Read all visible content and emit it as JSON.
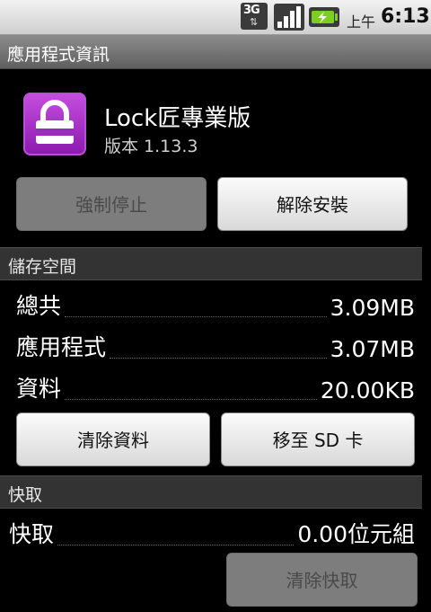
{
  "status_bar": {
    "network": "3G",
    "ampm": "上午",
    "time": "6:13",
    "icons": [
      "3g-data-icon",
      "signal-strength-icon",
      "battery-charging-icon"
    ]
  },
  "title_bar": {
    "title": "應用程式資訊"
  },
  "app": {
    "name": "Lock匠專業版",
    "version": "版本 1.13.3",
    "icon": "lock-app-icon",
    "icon_color": "#a633c7"
  },
  "app_actions": {
    "force_stop": "強制停止",
    "uninstall": "解除安裝"
  },
  "storage": {
    "header": "儲存空間",
    "rows": [
      {
        "label": "總共",
        "value": "3.09MB"
      },
      {
        "label": "應用程式",
        "value": "3.07MB"
      },
      {
        "label": "資料",
        "value": "20.00KB"
      }
    ],
    "clear_data": "清除資料",
    "move_to_sd": "移至 SD 卡"
  },
  "cache": {
    "header": "快取",
    "row": {
      "label": "快取",
      "value": "0.00位元組"
    },
    "clear_cache": "清除快取"
  }
}
